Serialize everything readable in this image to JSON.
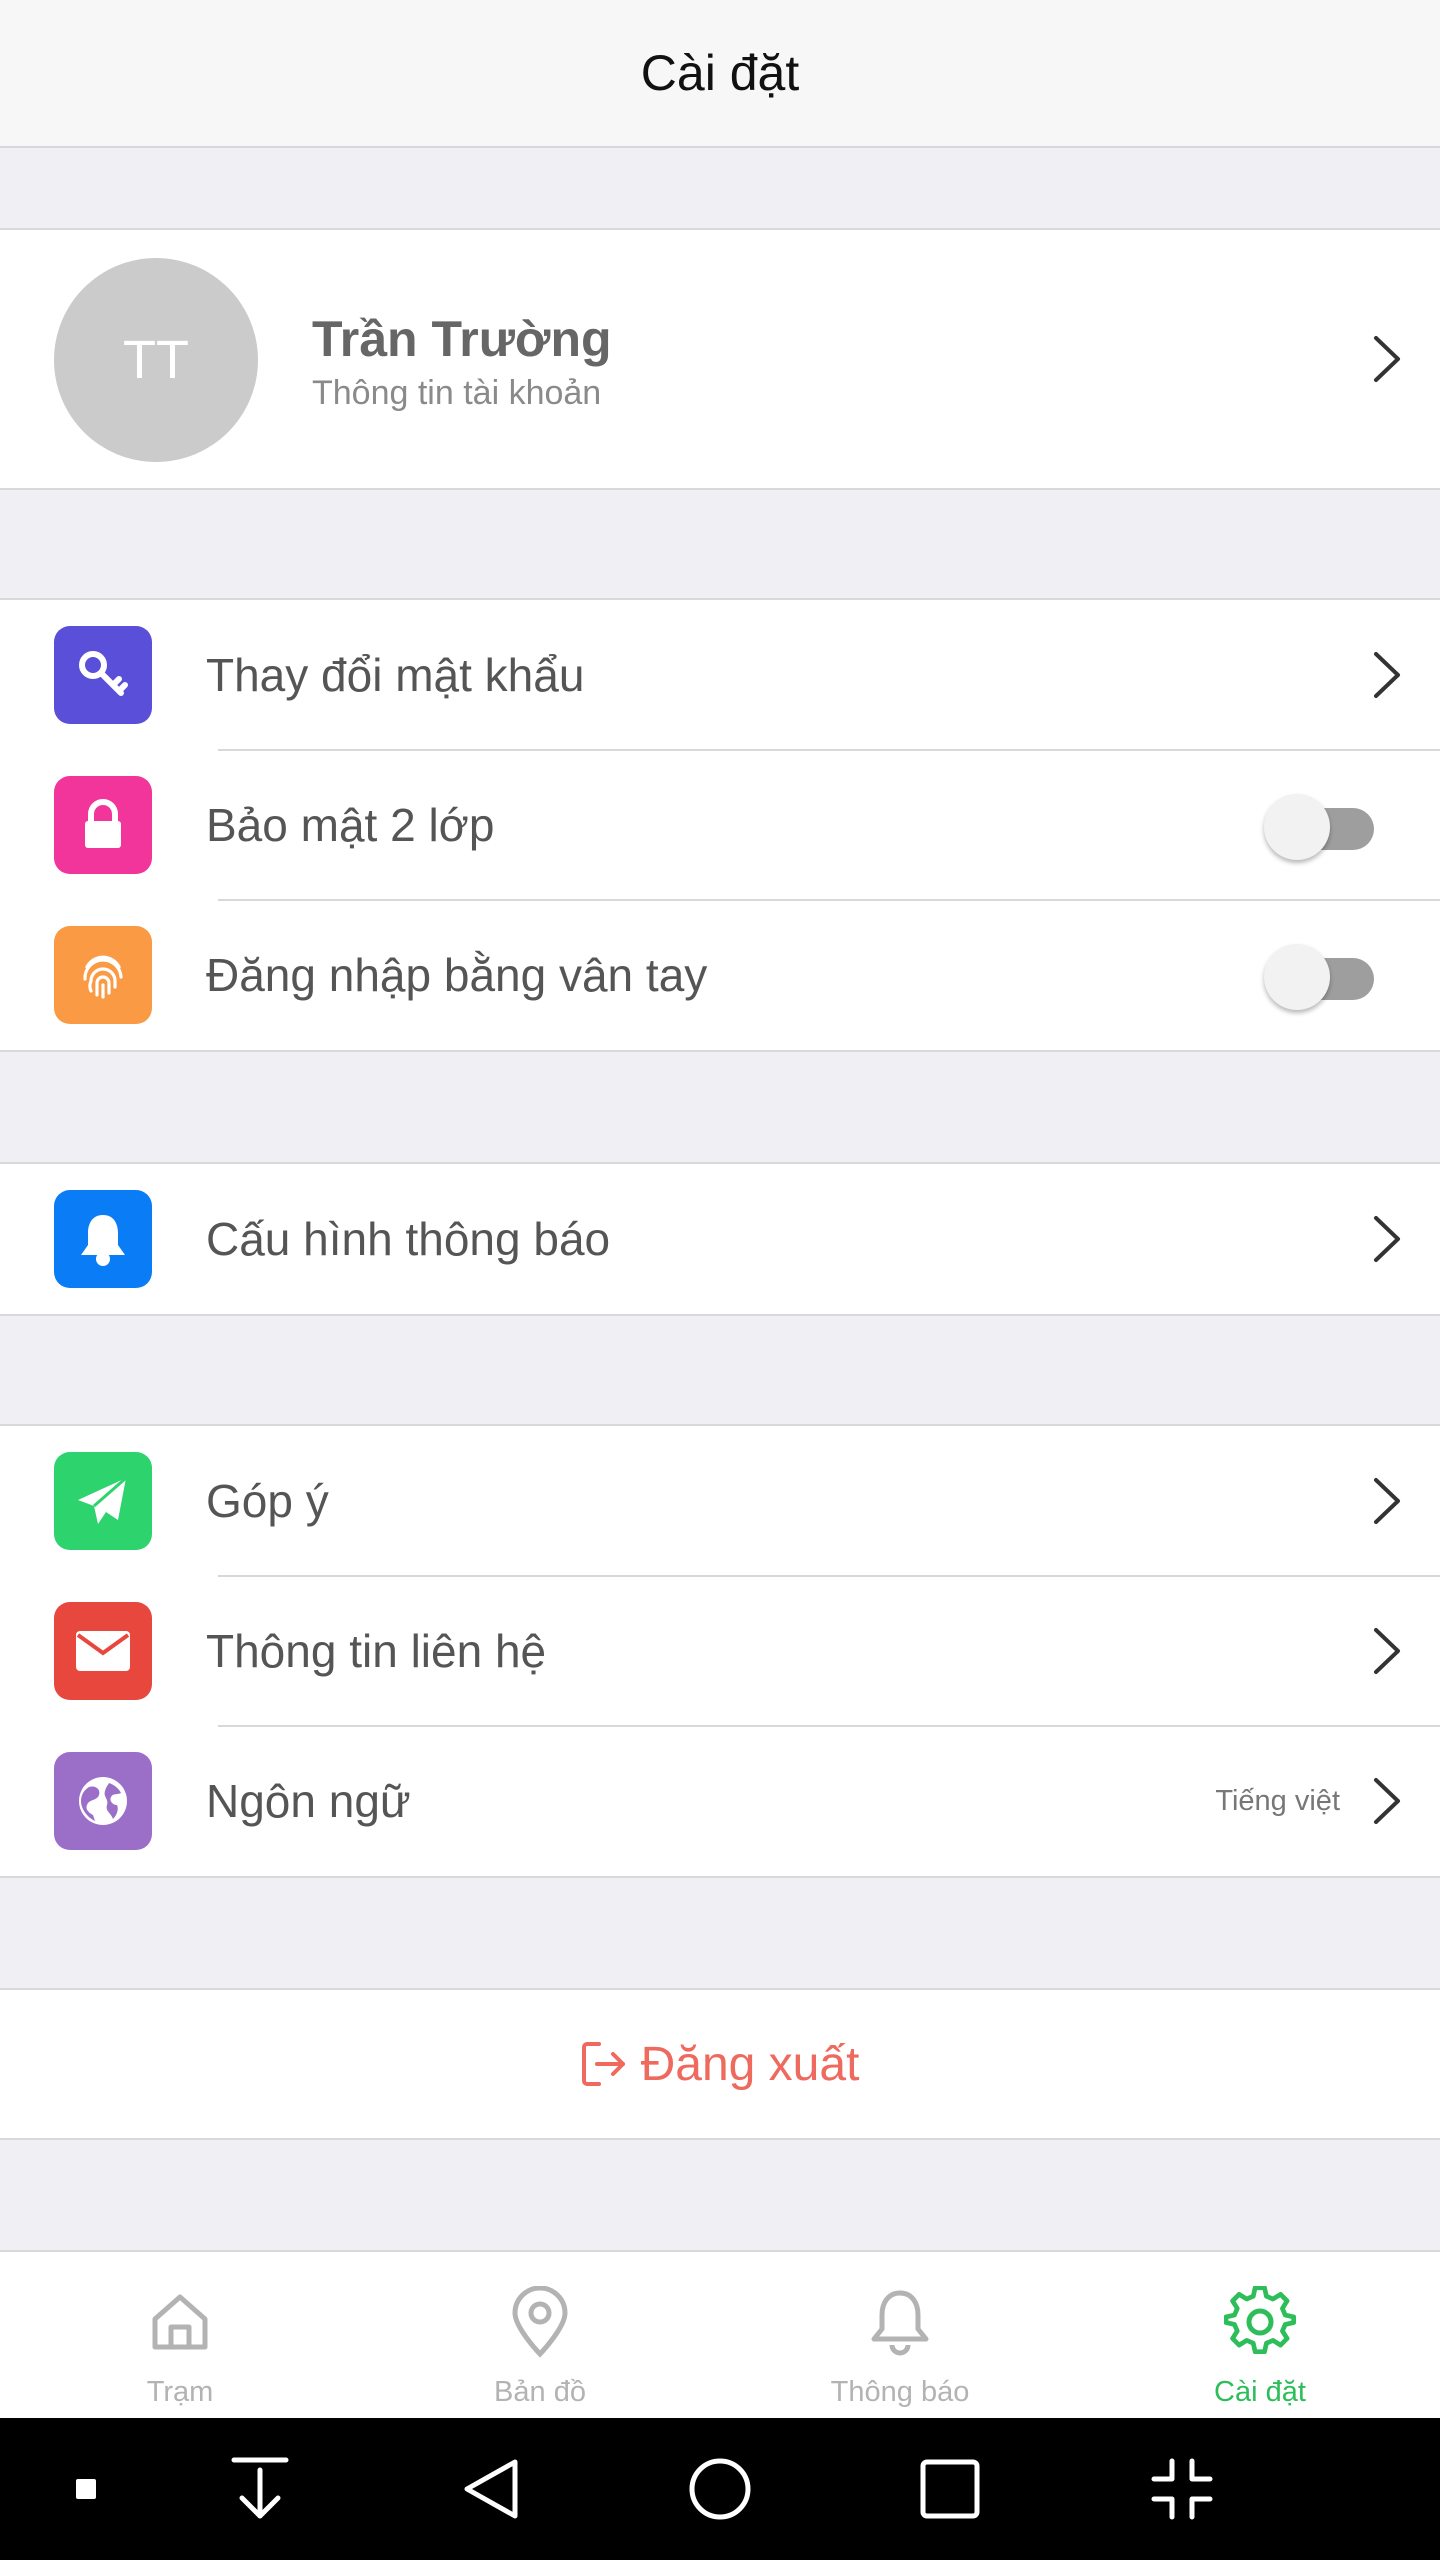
{
  "header": {
    "title": "Cài đặt"
  },
  "profile": {
    "initials": "TT",
    "name": "Trần Trường",
    "subtitle": "Thông tin tài khoản"
  },
  "security": {
    "items": [
      {
        "label": "Thay đổi mật khẩu",
        "icon": "key-icon",
        "color": "#5a4fd8"
      },
      {
        "label": "Bảo mật 2 lớp",
        "icon": "lock-icon",
        "color": "#f2359b",
        "toggle": false
      },
      {
        "label": "Đăng nhập bằng vân tay",
        "icon": "fingerprint-icon",
        "color": "#fa9a45",
        "toggle": false
      }
    ]
  },
  "notifications": {
    "items": [
      {
        "label": "Cấu hình thông báo",
        "icon": "bell-icon",
        "color": "#0a7cf5"
      }
    ]
  },
  "misc": {
    "items": [
      {
        "label": "Góp ý",
        "icon": "paper-plane-icon",
        "color": "#2dd36d"
      },
      {
        "label": "Thông tin liên hệ",
        "icon": "mail-icon",
        "color": "#e8473d"
      },
      {
        "label": "Ngôn ngữ",
        "icon": "globe-icon",
        "color": "#9b6fc8",
        "value": "Tiếng việt"
      }
    ]
  },
  "logout": {
    "label": "Đăng xuất",
    "icon": "logout-icon",
    "color": "#ee6a5f"
  },
  "tabbar": {
    "active_color": "#2dbe5a",
    "inactive_color": "#b3b3b3",
    "items": [
      {
        "label": "Trạm",
        "icon": "home-icon",
        "active": false
      },
      {
        "label": "Bản đồ",
        "icon": "map-pin-icon",
        "active": false
      },
      {
        "label": "Thông báo",
        "icon": "bell-icon",
        "active": false
      },
      {
        "label": "Cài đặt",
        "icon": "gear-icon",
        "active": true
      }
    ]
  },
  "system_nav": {
    "buttons": [
      "small-square-icon",
      "download-arrow-icon",
      "back-triangle-icon",
      "home-circle-icon",
      "recents-square-icon",
      "collapse-icon"
    ]
  }
}
